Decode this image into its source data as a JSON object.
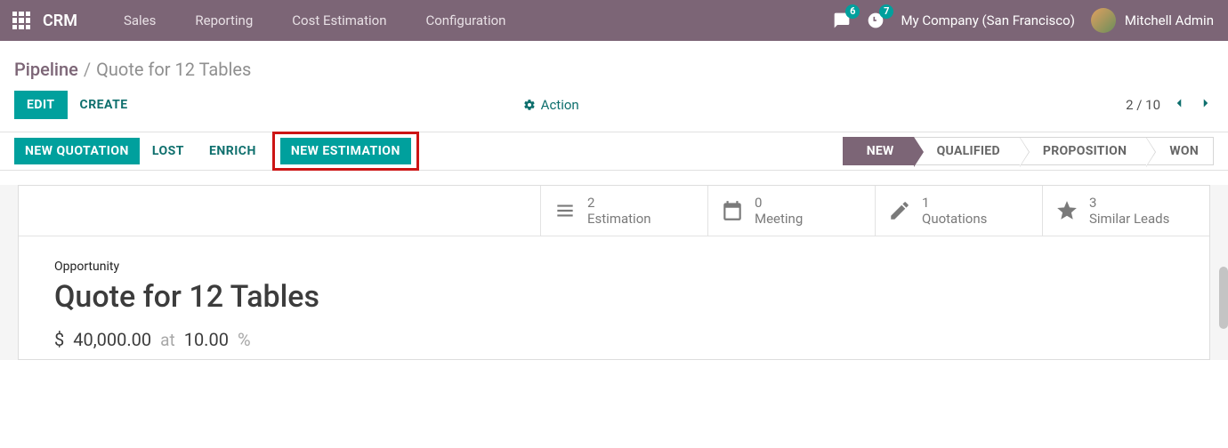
{
  "navbar": {
    "brand": "CRM",
    "items": [
      "Sales",
      "Reporting",
      "Cost Estimation",
      "Configuration"
    ],
    "messages_badge": "6",
    "activities_badge": "7",
    "company": "My Company (San Francisco)",
    "user": "Mitchell Admin"
  },
  "breadcrumb": {
    "parent": "Pipeline",
    "current": "Quote for 12 Tables"
  },
  "controls": {
    "edit": "EDIT",
    "create": "CREATE",
    "action": "Action",
    "pager": "2 / 10"
  },
  "statusbar": {
    "new_quotation": "NEW QUOTATION",
    "lost": "LOST",
    "enrich": "ENRICH",
    "new_estimation": "NEW ESTIMATION",
    "stages": [
      "NEW",
      "QUALIFIED",
      "PROPOSITION",
      "WON"
    ],
    "active_stage_index": 0
  },
  "stats": {
    "estimation": {
      "count": "2",
      "label": "Estimation"
    },
    "meeting": {
      "count": "0",
      "label": "Meeting"
    },
    "quotations": {
      "count": "1",
      "label": "Quotations"
    },
    "similar": {
      "count": "3",
      "label": "Similar Leads"
    }
  },
  "record": {
    "label": "Opportunity",
    "title": "Quote for 12 Tables",
    "currency": "$",
    "amount": "40,000.00",
    "at": "at",
    "probability": "10.00",
    "pct_sign": "%"
  }
}
